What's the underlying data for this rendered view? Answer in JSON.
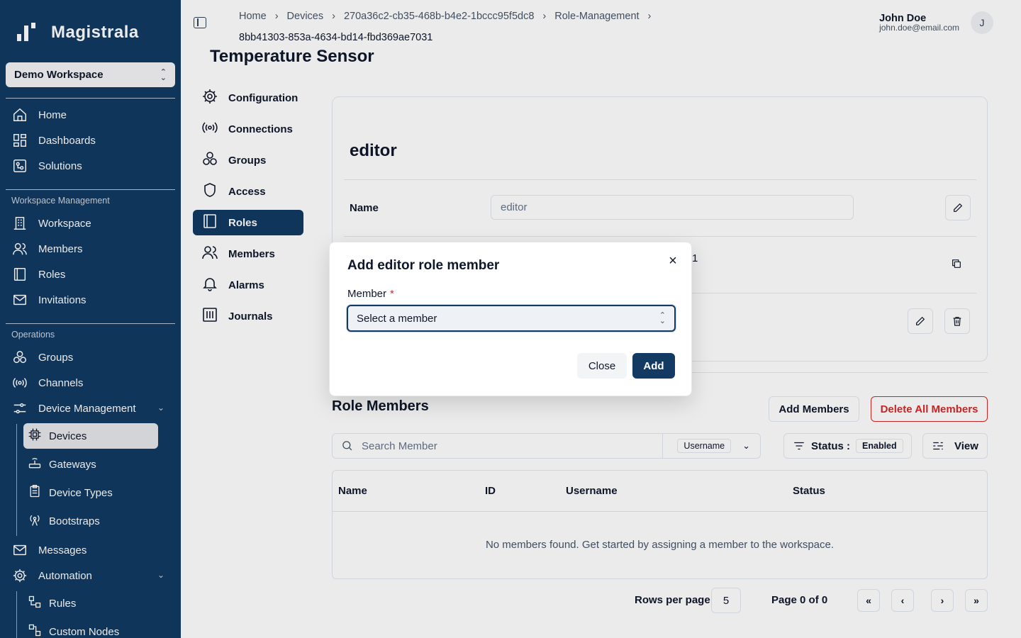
{
  "app": {
    "name": "Magistrala",
    "workspace": "Demo Workspace"
  },
  "sidebar": {
    "top_items": [
      {
        "label": "Home",
        "icon": "home-icon"
      },
      {
        "label": "Dashboards",
        "icon": "dashboard-icon"
      },
      {
        "label": "Solutions",
        "icon": "solutions-icon"
      }
    ],
    "workspace_section": "Workspace Management",
    "workspace_items": [
      {
        "label": "Workspace",
        "icon": "building-icon"
      },
      {
        "label": "Members",
        "icon": "users-icon"
      },
      {
        "label": "Roles",
        "icon": "book-icon"
      },
      {
        "label": "Invitations",
        "icon": "mail-icon"
      }
    ],
    "operations_section": "Operations",
    "operations_items": [
      {
        "label": "Groups",
        "icon": "groups-icon"
      },
      {
        "label": "Channels",
        "icon": "broadcast-icon"
      },
      {
        "label": "Device Management",
        "icon": "sliders-icon"
      }
    ],
    "device_sub_items": [
      {
        "label": "Devices",
        "icon": "chip-icon",
        "active": true
      },
      {
        "label": "Gateways",
        "icon": "router-icon"
      },
      {
        "label": "Device Types",
        "icon": "clipboard-icon"
      },
      {
        "label": "Bootstraps",
        "icon": "antenna-icon"
      }
    ],
    "more_items": [
      {
        "label": "Messages",
        "icon": "message-icon"
      },
      {
        "label": "Automation",
        "icon": "gear-icon"
      }
    ],
    "automation_sub_items": [
      {
        "label": "Rules",
        "icon": "rules-icon"
      },
      {
        "label": "Custom Nodes",
        "icon": "nodes-icon"
      }
    ]
  },
  "header": {
    "breadcrumbs": [
      "Home",
      "Devices",
      "270a36c2-cb35-468b-b4e2-1bccc95f5dc8",
      "Role-Management",
      "8bb41303-853a-4634-bd14-fbd369ae7031"
    ],
    "user_name": "John Doe",
    "user_email": "john.doe@email.com",
    "avatar_initial": "J"
  },
  "page": {
    "title": "Temperature Sensor"
  },
  "subnav": [
    {
      "label": "Configuration",
      "icon": "gear-icon"
    },
    {
      "label": "Connections",
      "icon": "broadcast-icon"
    },
    {
      "label": "Groups",
      "icon": "groups-icon"
    },
    {
      "label": "Access",
      "icon": "shield-icon"
    },
    {
      "label": "Roles",
      "icon": "book-icon",
      "active": true
    },
    {
      "label": "Members",
      "icon": "users-icon"
    },
    {
      "label": "Alarms",
      "icon": "bell-icon"
    },
    {
      "label": "Journals",
      "icon": "journal-icon"
    }
  ],
  "role": {
    "title": "editor",
    "name_label": "Name",
    "name_value": "editor",
    "partial_id_suffix": "1"
  },
  "members": {
    "title": "Role Members",
    "add_button": "Add Members",
    "delete_button": "Delete All Members",
    "search_placeholder": "Search Member",
    "search_field": "Username",
    "status_label": "Status :",
    "status_value": "Enabled",
    "view_label": "View",
    "columns": [
      "Name",
      "ID",
      "Username",
      "Status"
    ],
    "empty_message": "No members found. Get started by assigning a member to the workspace.",
    "rows_per_page_label": "Rows per page",
    "rows_per_page": "5",
    "page_info": "Page 0 of 0",
    "first_btn": "«",
    "prev_btn": "‹",
    "next_btn": "›",
    "last_btn": "»"
  },
  "modal": {
    "title": "Add editor role member",
    "field_label": "Member",
    "required_mark": "*",
    "select_placeholder": "Select a member",
    "close_label": "Close",
    "add_label": "Add",
    "close_icon": "×"
  },
  "colors": {
    "brand": "#123a63",
    "danger": "#dc2626"
  }
}
